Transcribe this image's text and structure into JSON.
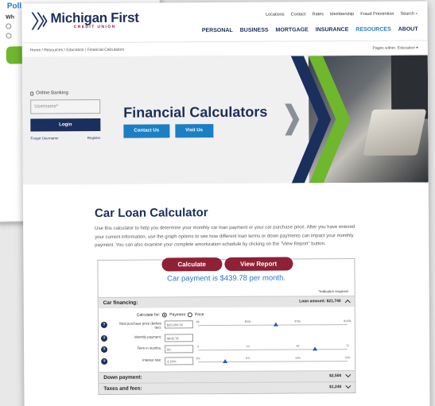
{
  "back_card": {
    "poll_label": "Poll",
    "question_prefix": "Wh"
  },
  "header": {
    "logo_name": "Michigan First",
    "logo_sub": "CREDIT UNION",
    "util_nav": [
      "Locations",
      "Contact",
      "Rates",
      "Membership",
      "Fraud Prevention",
      "Search"
    ],
    "main_nav": [
      "PERSONAL",
      "BUSINESS",
      "MORTGAGE",
      "INSURANCE",
      "RESOURCES",
      "ABOUT"
    ],
    "active_nav": "RESOURCES"
  },
  "breadcrumb": "Home / Resources / Education / Financial Calculators",
  "pages_within": "Pages within: Education",
  "login": {
    "title": "Online Banking",
    "username_placeholder": "Username*",
    "login_button": "Login",
    "forgot_link": "Forgot Username",
    "register_link": "Register"
  },
  "hero": {
    "title": "Financial Calculators",
    "buttons": [
      "Contact Us",
      "Visit Us"
    ]
  },
  "calculator": {
    "title": "Car Loan Calculator",
    "description": "Use this calculator to help you determine your monthly car loan payment or your car purchase price. After you have entered your current information, use the graph options to see how different loan terms or down payments can impact your monthly payment. You can also examine your complete amortization schedule by clicking on the \"View Report\" button.",
    "calculate_button": "Calculate",
    "report_button": "View Report",
    "payment_text": "Car payment is $439.78 per month.",
    "required_note": "*indicates required",
    "calculate_for_label": "Calculate for:",
    "calculate_for_options": [
      "Payment",
      "Price"
    ],
    "calculate_for_selected": "Payment",
    "sections": {
      "financing": {
        "label": "Car financing:",
        "amount": "Loan amount: $21,740"
      },
      "down": {
        "label": "Down payment:",
        "amount": "$2,500"
      },
      "taxes": {
        "label": "Taxes and fees:",
        "amount": "$1,240"
      }
    },
    "fields": [
      {
        "label": "Total purchase price (before tax):",
        "value": "$25,000.00",
        "ticks": [
          "$0",
          "$50k",
          "$75k",
          "$100k"
        ],
        "slider_fraction": 0.52
      },
      {
        "label": "Monthly payment:",
        "value": "$439.78"
      },
      {
        "label": "Term in months:",
        "value": "60",
        "ticks": [
          "0",
          "24",
          "48",
          "72"
        ],
        "slider_fraction": 0.78
      },
      {
        "label": "Interest rate:",
        "value": "4.24%",
        "ticks": [
          "0%",
          "8%",
          "16%",
          "24%"
        ],
        "slider_fraction": 0.18
      }
    ]
  }
}
